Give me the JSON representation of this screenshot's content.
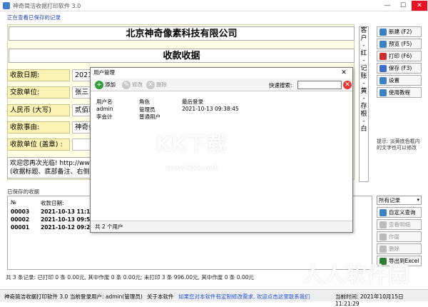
{
  "window": {
    "title": "神奇简洁收据打印软件 3.0",
    "min": "—",
    "max": "☐",
    "close": "✕"
  },
  "status_head": "正在查看已保存的记录",
  "receipt": {
    "company": "北京神奇像素科技有限公司",
    "doc_title": "收款收据",
    "fields": [
      {
        "label": "收款日期:",
        "value": "2021/"
      },
      {
        "label": "交款单位:",
        "value": "张三"
      },
      {
        "label": "人民币 (大写)",
        "value": "贰佰玖"
      },
      {
        "label": "收款事由:",
        "value": "神奇条"
      },
      {
        "label": "收款单位 (盖章) :",
        "value": ""
      }
    ],
    "remark_line1": "欢迎您再次光临! http://ww",
    "remark_line2": "(收据标题、底部备注、右侧",
    "vertical_col": [
      "客",
      "户",
      "-",
      "红",
      "-",
      "记",
      "账",
      "-",
      "黄",
      "-",
      "存",
      "根",
      "-",
      "白"
    ]
  },
  "side_buttons": [
    {
      "label": "新建 (F2)",
      "icon": "new-icon",
      "color": "#3b82c4",
      "disabled": false
    },
    {
      "label": "预览 (F5)",
      "icon": "preview-icon",
      "color": "#3b82c4",
      "disabled": false
    },
    {
      "label": "打印 (F6)",
      "icon": "print-icon",
      "color": "#c9302c",
      "disabled": false
    },
    {
      "label": "保存 (F3)",
      "icon": "save-icon",
      "color": "#3b6ec4",
      "disabled": false
    },
    {
      "label": "设置",
      "icon": "settings-icon",
      "color": "#3b82c4",
      "disabled": false
    },
    {
      "label": "使用教程",
      "icon": "tutorial-icon",
      "color": "#3b82c4",
      "disabled": false
    }
  ],
  "tip": "提示: 淡黄底色框内的文字也可以修改",
  "list_title": "已保存的收据",
  "list": {
    "headers": [
      "№",
      "收款日期:"
    ],
    "rows": [
      {
        "no": "00003",
        "date": "2021-10-13 11:12:3"
      },
      {
        "no": "00002",
        "date": "2021-10-13 09:56:3"
      },
      {
        "no": "00001",
        "date": "2021-10-12 09:20:3"
      }
    ]
  },
  "records_filter": "所有记录",
  "record_buttons": [
    {
      "label": "自定义查询",
      "icon": "query-icon",
      "disabled": false
    },
    {
      "label": "查看明细",
      "icon": "detail-icon",
      "disabled": true
    },
    {
      "label": "作废",
      "icon": "void-icon",
      "disabled": true
    },
    {
      "label": "删除",
      "icon": "delete-icon",
      "disabled": true
    },
    {
      "label": "导出到Excel",
      "icon": "excel-icon",
      "disabled": false
    }
  ],
  "summary": "共 3 条记录: 已打印 0 条 0.00元, 其中作废 0 条 0.00元; 未打印 3 条 996.00元, 其中作废 0 条 0.00元",
  "bottom": {
    "app": "神奇简洁收据打印软件 3.0",
    "user": "当前登录用户: admin(管理员)",
    "about": "关于本软件",
    "promo": "如果您对本软件有定制修改需求, 欢迎点击这里联系我们",
    "time": "当前时间: 2021年10月15日 11:21:29"
  },
  "dialog": {
    "title": "用户管理",
    "close": "✕",
    "toolbar": {
      "add": "添加",
      "edit": "修改",
      "delete": "删除",
      "search_label": "快速搜索:"
    },
    "headers": [
      "用户名",
      "角色",
      "最后登录"
    ],
    "rows": [
      {
        "user": "admin",
        "role": "管理员",
        "last": "2021-10-13 09:38:45"
      },
      {
        "user": "李会计",
        "role": "普通用户",
        "last": ""
      }
    ],
    "footer": "共 2 个用户"
  },
  "watermarks": {
    "logo_text": "KK下载",
    "url": "www.kkx.net",
    "brand": "人人软件园"
  }
}
